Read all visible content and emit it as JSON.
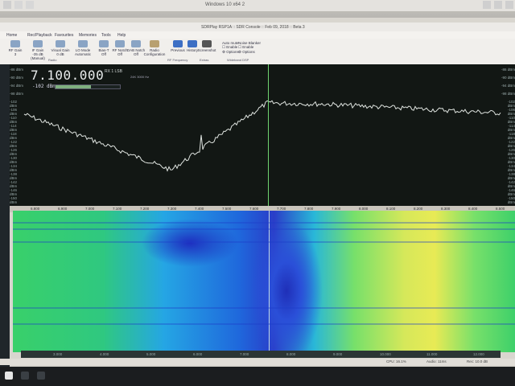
{
  "window": {
    "vm_title": "Windows 10 x64 2"
  },
  "app": {
    "title": "SDRPlay RSP1A :: SDR Console :: Feb 09, 2018 :: Beta 3",
    "menu": [
      "Home",
      "Rec/Playback",
      "Favourites",
      "Memories",
      "Tools",
      "Help"
    ],
    "ribbon": {
      "buttons": [
        {
          "id": "rf-gain",
          "label": "RF Gain",
          "sub": "3"
        },
        {
          "id": "if-gain",
          "label": "IF Gain",
          "sub": "-35 dB (Manual)"
        },
        {
          "id": "visual-gain",
          "label": "Visual Gain",
          "sub": "0 dB"
        },
        {
          "id": "lo-mode",
          "label": "LO Mode",
          "sub": "Automatic"
        },
        {
          "id": "bias-t",
          "label": "Bias-T",
          "sub": "Off"
        },
        {
          "id": "rf-notch",
          "label": "RF Notch",
          "sub": "Off"
        },
        {
          "id": "dab-notch",
          "label": "DAB Notch",
          "sub": "Off"
        },
        {
          "id": "radio-config",
          "label": "Radio Configuration",
          "sub": ""
        },
        {
          "id": "previous",
          "label": "Previous",
          "sub": ""
        },
        {
          "id": "history",
          "label": "History",
          "sub": ""
        },
        {
          "id": "screenshot",
          "label": "Screenshot",
          "sub": ""
        }
      ],
      "audio_mute": {
        "title": "Auto mute",
        "enable": "Enable",
        "options": "Options"
      },
      "noise_blanker": {
        "title": "Noise Blanker",
        "enable": "Enable",
        "options": "Options"
      },
      "groups": {
        "radio": "Radio",
        "rf_frequency": "RF Frequency",
        "extras": "Extras",
        "wideband_dsp": "Wideband DSP"
      }
    }
  },
  "spectrum": {
    "frequency": "7.100.000",
    "rx": "RX 1",
    "mode": "LSB",
    "info": "24K   3000 Hz",
    "level": "-102 dBm",
    "smeter_fraction": 0.55,
    "db_ticks": [
      "-86 dBm",
      "-90 dBm",
      "-94 dBm",
      "-98 dBm",
      "-102 dBm",
      "-106 dBm",
      "-110 dBm",
      "-114 dBm",
      "-118 dBm",
      "-122 dBm",
      "-126 dBm",
      "-130 dBm",
      "-134 dBm",
      "-138 dBm",
      "-142 dBm",
      "-146 dBm",
      "-150 dBm"
    ],
    "freq_ticks": [
      "6.800",
      "6.900",
      "7.000",
      "7.100",
      "7.200",
      "7.300",
      "7.400",
      "7.500",
      "7.600",
      "7.700",
      "7.800",
      "7.900",
      "8.000",
      "8.100",
      "8.200",
      "8.300",
      "8.400",
      "8.500"
    ]
  },
  "waterfall": {
    "bottom_ticks": [
      "3.000",
      "4.000",
      "5.000",
      "6.000",
      "7.000",
      "8.000",
      "9.000",
      "10.000",
      "11.000",
      "12.000"
    ]
  },
  "status": {
    "cpu": "CPU: 16.1%",
    "audio": "Audio: 11ms",
    "record": "Rec: 10.0 dB"
  },
  "colors": {
    "trace": "#dfe4e0",
    "cursor": "#6fd46f",
    "bg": "#121714"
  }
}
